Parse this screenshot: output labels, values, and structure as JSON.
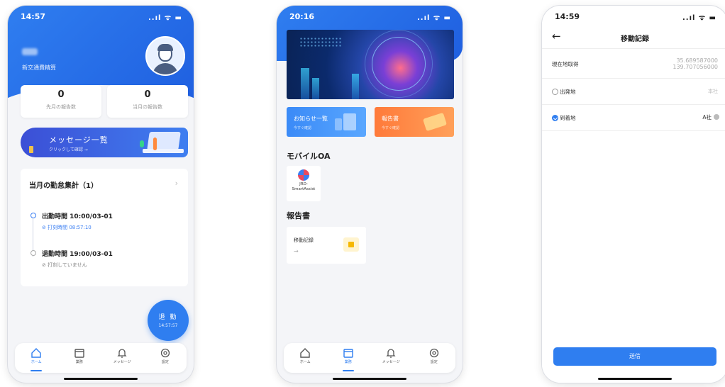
{
  "phone1": {
    "status": {
      "time": "14:57",
      "signal": "..ıl ᯤ ▬"
    },
    "user": {
      "subtitle": "新交通費精算"
    },
    "stats": [
      {
        "value": "0",
        "label": "先月の報告数"
      },
      {
        "value": "0",
        "label": "当月の報告数"
      }
    ],
    "banner": {
      "title": "メッセージ一覧",
      "subtitle": "クリックして確認 →"
    },
    "attendance": {
      "title": "当月の勤怠集計（1）",
      "chevron": "›",
      "in_label": "出勤時間 10:00/03-01",
      "in_sub": "打刻時間 08:57:10",
      "out_label": "退勤時間 19:00/03-01",
      "out_sub": "打刻していません"
    },
    "fab": {
      "label": "退 勤",
      "time": "14:57:57"
    },
    "tabs": [
      {
        "label": "ホーム",
        "icon": "home-icon"
      },
      {
        "label": "業務",
        "icon": "calendar-icon"
      },
      {
        "label": "メッセージ",
        "icon": "bell-icon"
      },
      {
        "label": "設定",
        "icon": "gear-icon"
      }
    ]
  },
  "phone2": {
    "status": {
      "time": "20:16",
      "signal": "..ıl ᯤ ▬"
    },
    "cards": [
      {
        "title": "お知らせ一覧",
        "subtitle": "今すぐ確認",
        "color": "#3a8af7"
      },
      {
        "title": "報告書",
        "subtitle": "今すぐ確認",
        "color": "#ff8a3d"
      }
    ],
    "section_mobile": "モバイルOA",
    "app": {
      "line1": "JRD-",
      "line2": "SmartAssist"
    },
    "section_report": "報告書",
    "report_card": {
      "title": "移動記録",
      "arrow": "→"
    },
    "tabs": [
      {
        "label": "ホーム",
        "icon": "home-icon"
      },
      {
        "label": "業務",
        "icon": "calendar-icon"
      },
      {
        "label": "メッセージ",
        "icon": "bell-icon"
      },
      {
        "label": "設定",
        "icon": "gear-icon"
      }
    ]
  },
  "phone3": {
    "status": {
      "time": "14:59",
      "signal": "..ıl ᯤ ▬"
    },
    "title": "移動記録",
    "back": "←",
    "rows": {
      "location_label": "現在地取得",
      "lat": "35.689587000",
      "lng": "139.707056000",
      "origin_label": "出発地",
      "origin_value": "本社",
      "dest_label": "到着地",
      "dest_value": "A社"
    },
    "send_button": "送信"
  },
  "colors": {
    "primary": "#2f7ef0",
    "orange": "#ff8a3d"
  }
}
